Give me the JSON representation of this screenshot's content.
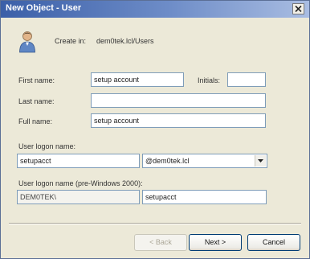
{
  "window": {
    "title": "New Object - User"
  },
  "header": {
    "create_in_label": "Create in:",
    "create_in_path": "dem0tek.lcl/Users"
  },
  "form": {
    "first_name_label": "First name:",
    "first_name_value": "setup account",
    "initials_label": "Initials:",
    "initials_value": "",
    "last_name_label": "Last name:",
    "last_name_value": "",
    "full_name_label": "Full name:",
    "full_name_value": "setup account",
    "logon_label": "User logon name:",
    "logon_value": "setupacct",
    "domain_suffix_value": "@dem0tek.lcl",
    "pre2000_label": "User logon name (pre-Windows 2000):",
    "pre2000_domain_value": "DEM0TEK\\",
    "pre2000_name_value": "setupacct"
  },
  "buttons": {
    "back_label": "< Back",
    "next_label": "Next >",
    "cancel_label": "Cancel"
  },
  "icons": {
    "user": "user-icon",
    "close": "close-icon",
    "dropdown": "chevron-down-icon"
  }
}
